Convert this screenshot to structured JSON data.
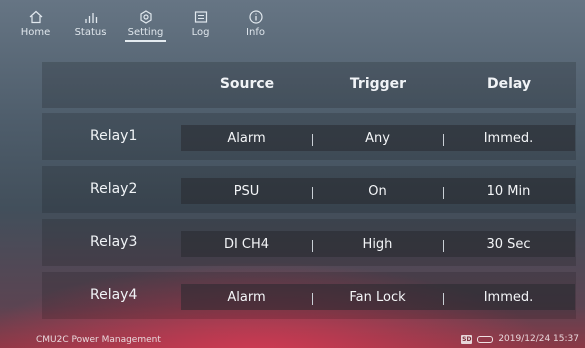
{
  "nav": {
    "tabs": [
      {
        "label": "Home",
        "icon": "home-icon"
      },
      {
        "label": "Status",
        "icon": "bar-chart-icon"
      },
      {
        "label": "Setting",
        "icon": "gear-icon",
        "active": true
      },
      {
        "label": "Log",
        "icon": "log-icon"
      },
      {
        "label": "Info",
        "icon": "info-icon"
      }
    ]
  },
  "table": {
    "headers": [
      "Source",
      "Trigger",
      "Delay"
    ],
    "rows": [
      {
        "name": "Relay1",
        "source": "Alarm",
        "trigger": "Any",
        "delay": "Immed."
      },
      {
        "name": "Relay2",
        "source": "PSU",
        "trigger": "On",
        "delay": "10 Min"
      },
      {
        "name": "Relay3",
        "source": "DI CH4",
        "trigger": "High",
        "delay": "30 Sec"
      },
      {
        "name": "Relay4",
        "source": "Alarm",
        "trigger": "Fan Lock",
        "delay": "Immed."
      }
    ]
  },
  "footer": {
    "device_label": "CMU2C Power Management",
    "sd_label": "SD",
    "datetime": "2019/12/24 15:37"
  },
  "colors": {
    "accent_glow": "#d63a54",
    "background": "#4e5d6b"
  }
}
